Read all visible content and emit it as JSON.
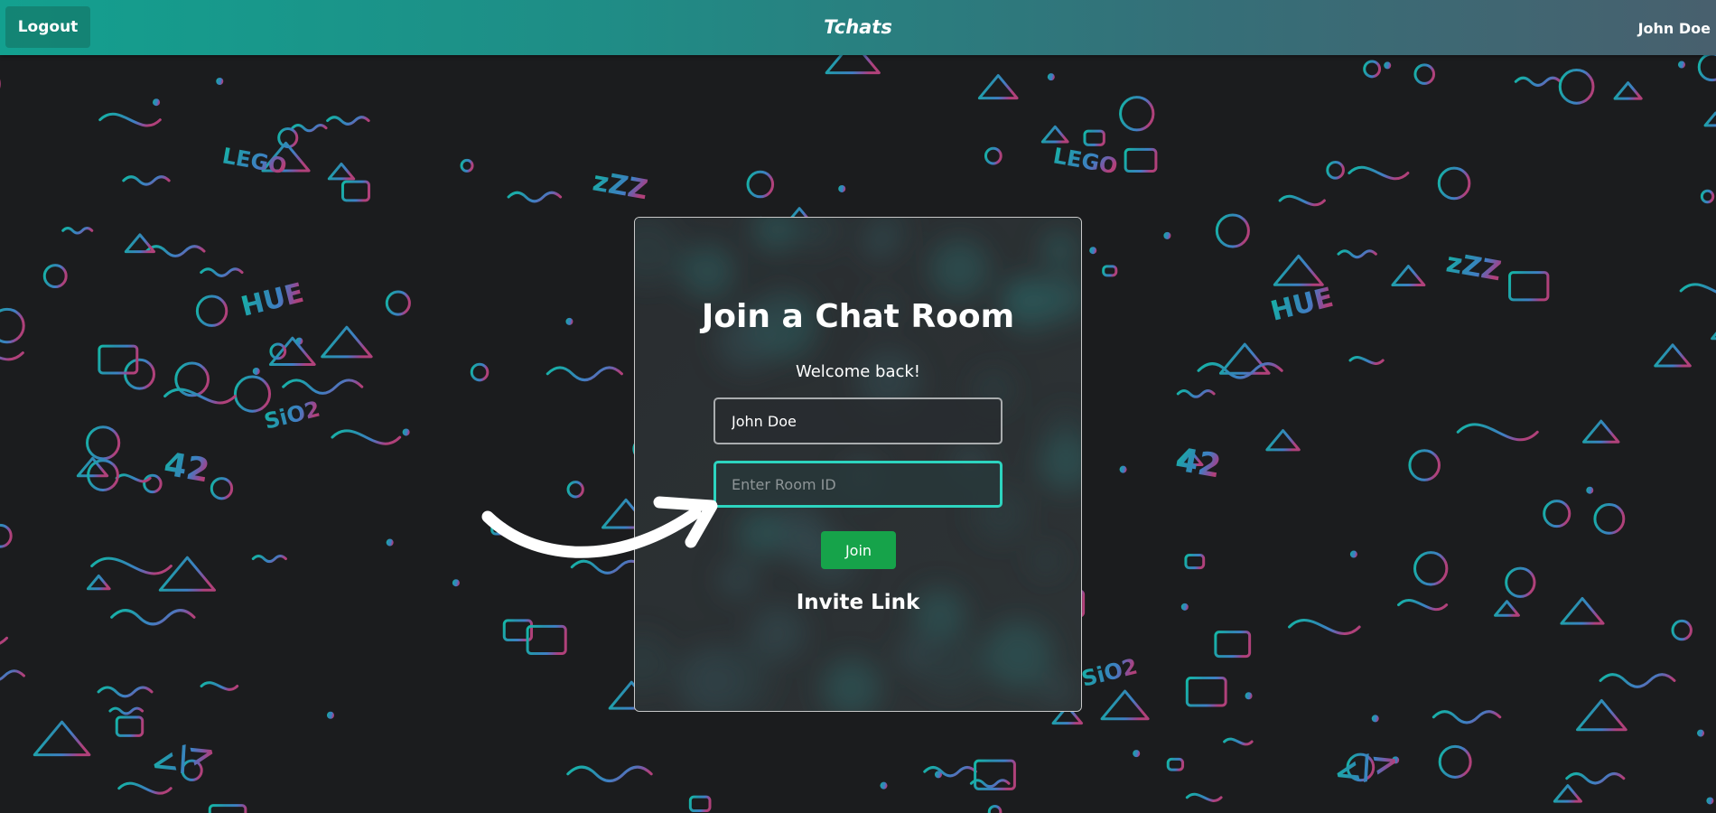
{
  "navbar": {
    "logout_label": "Logout",
    "brand": "Tchats",
    "username": "John Doe"
  },
  "card": {
    "title": "Join a Chat Room",
    "welcome": "Welcome back!",
    "name_value": "John Doe",
    "room_placeholder": "Enter Room ID",
    "join_label": "Join",
    "invite_label": "Invite Link"
  },
  "background": {
    "doodle_words": [
      "LEGO",
      "HUE",
      "42",
      "SiO2",
      "zZZ",
      "</>"
    ]
  },
  "colors": {
    "navbar_start": "#13a08f",
    "navbar_end": "#48606e",
    "room_input_border": "#2dd4bf",
    "join_button": "#16a34a",
    "doodle_left": "#14b8a6",
    "doodle_right": "#b0417a"
  },
  "icons": [
    "logout-icon-none",
    "arrow-pointer"
  ]
}
